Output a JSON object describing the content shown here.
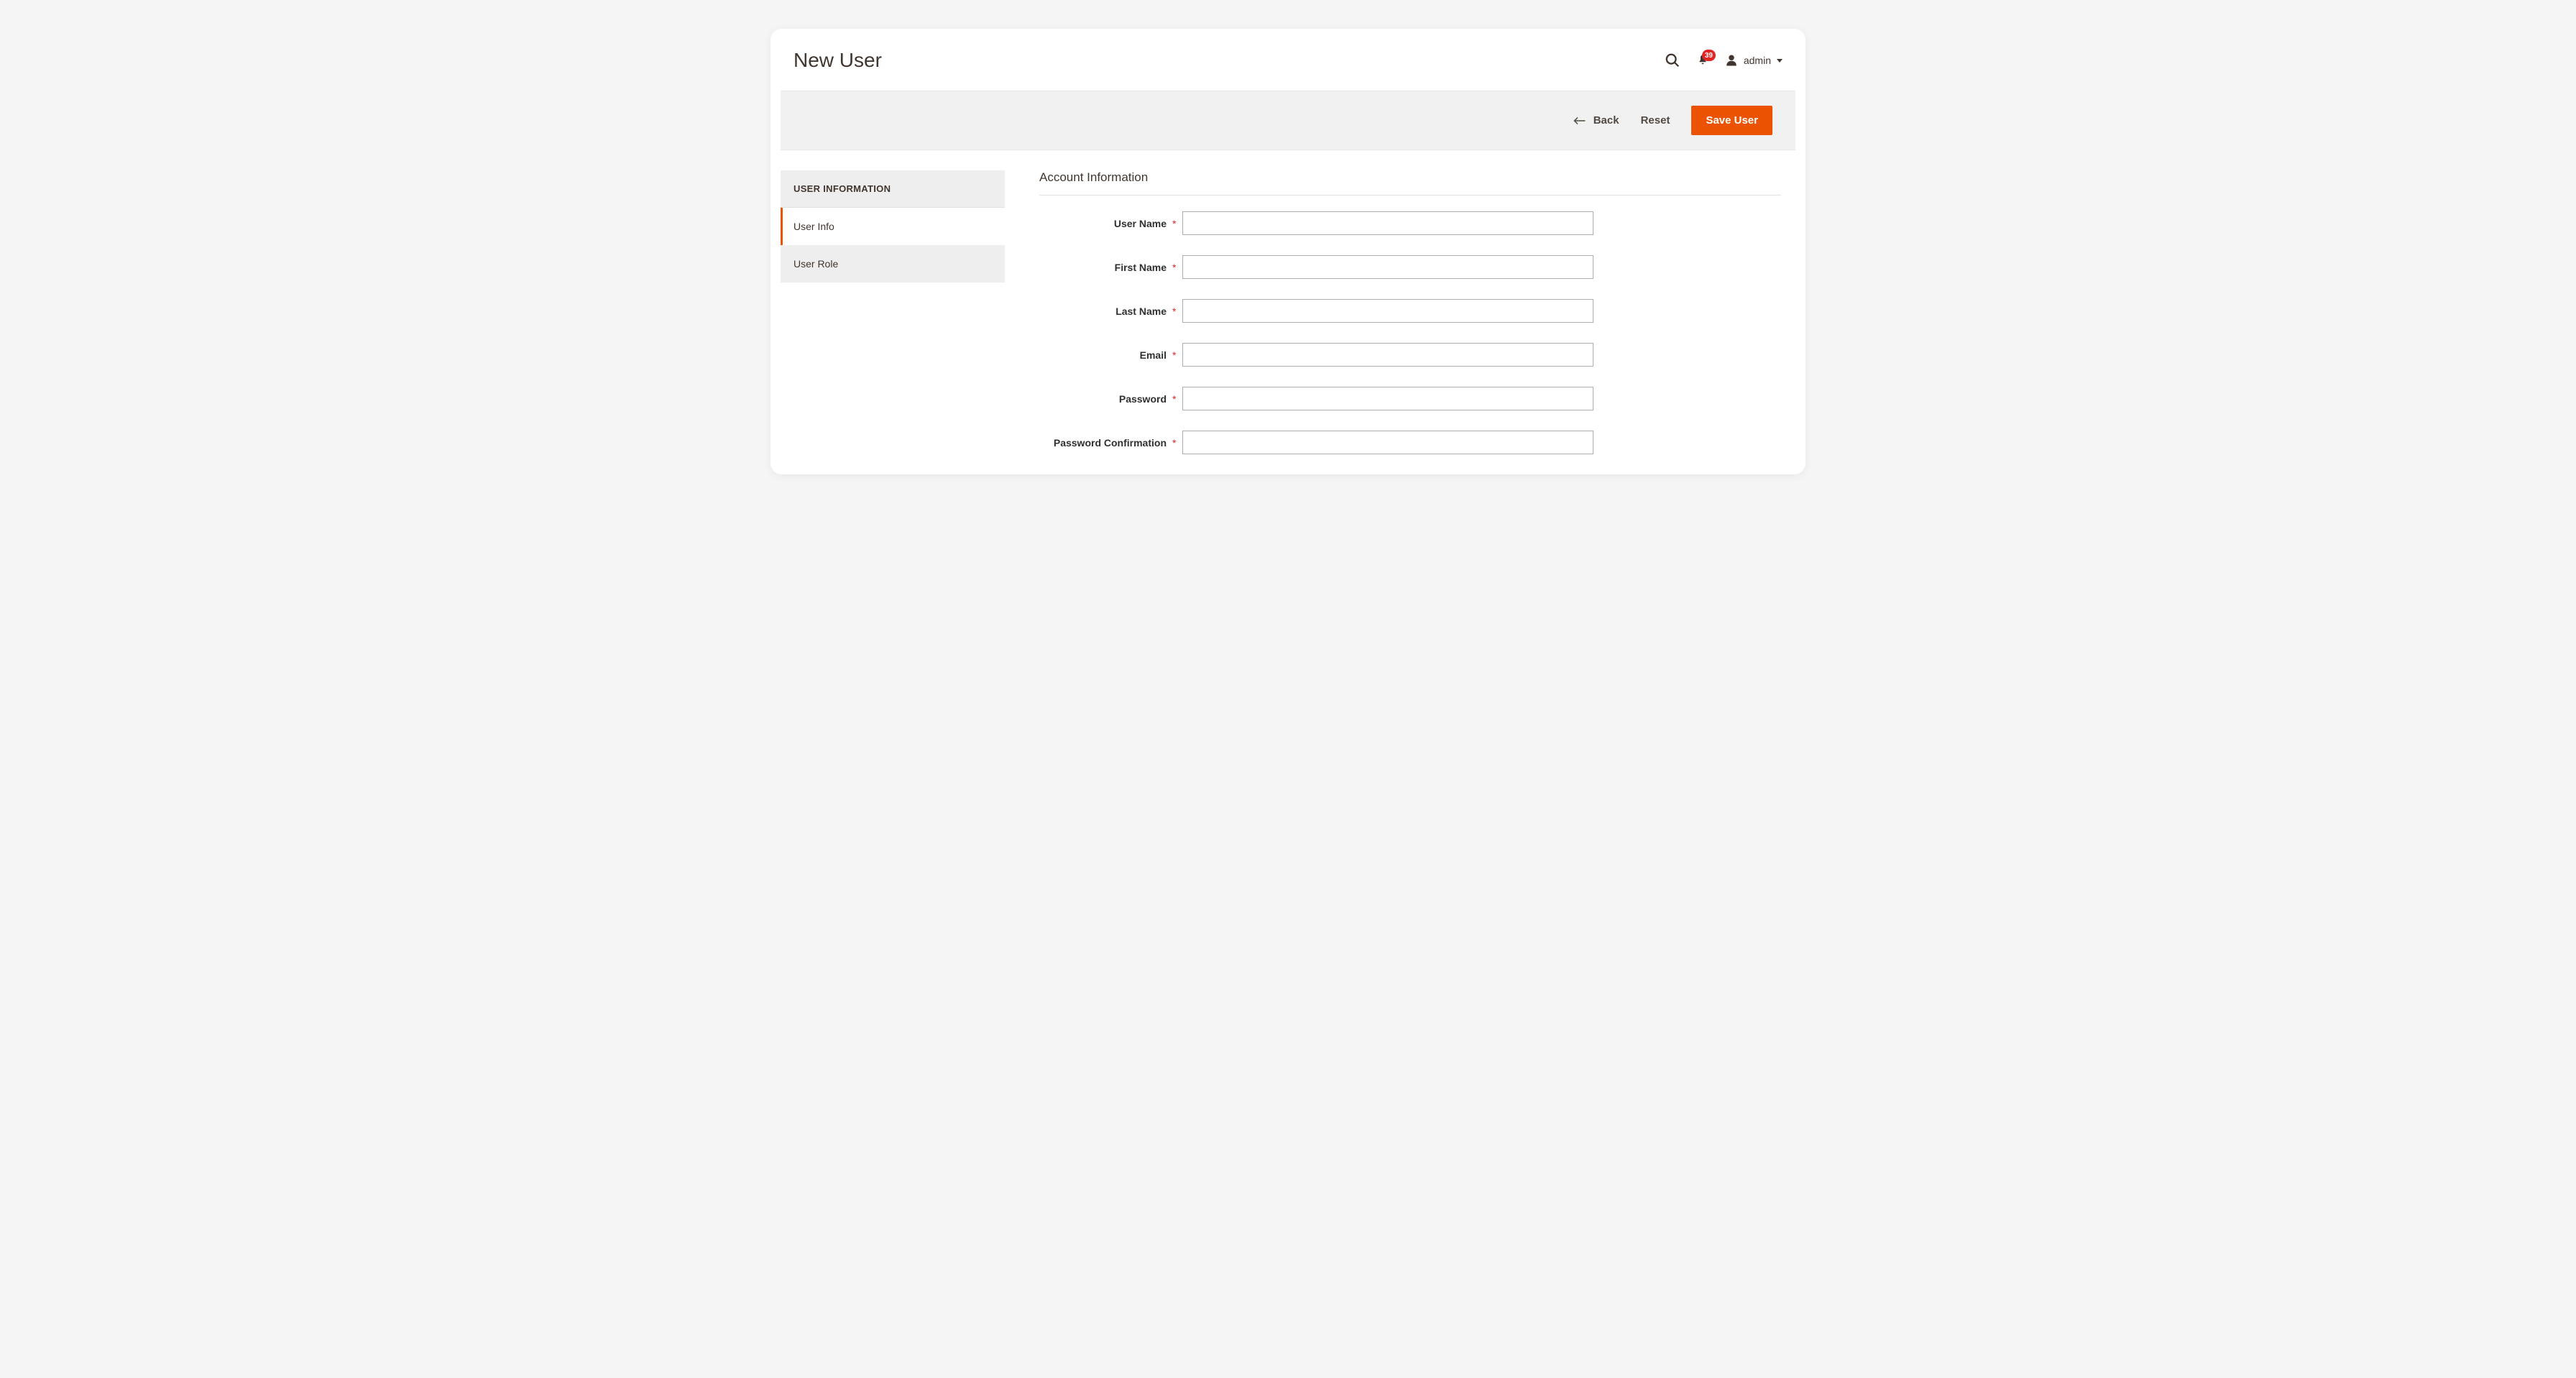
{
  "header": {
    "page_title": "New User",
    "notification_count": "39",
    "user_label": "admin"
  },
  "action_bar": {
    "back_label": "Back",
    "reset_label": "Reset",
    "save_label": "Save User"
  },
  "sidebar": {
    "header": "USER INFORMATION",
    "tabs": [
      {
        "label": "User Info",
        "active": true
      },
      {
        "label": "User Role",
        "active": false
      }
    ]
  },
  "form": {
    "section_title": "Account Information",
    "fields": [
      {
        "label": "User Name",
        "required": true,
        "type": "text",
        "value": ""
      },
      {
        "label": "First Name",
        "required": true,
        "type": "text",
        "value": ""
      },
      {
        "label": "Last Name",
        "required": true,
        "type": "text",
        "value": ""
      },
      {
        "label": "Email",
        "required": true,
        "type": "text",
        "value": ""
      },
      {
        "label": "Password",
        "required": true,
        "type": "password",
        "value": ""
      },
      {
        "label": "Password Confirmation",
        "required": true,
        "type": "password",
        "value": ""
      }
    ]
  }
}
